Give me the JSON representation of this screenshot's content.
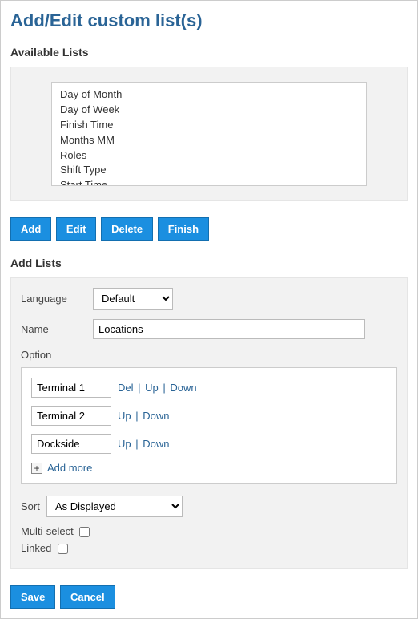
{
  "title": "Add/Edit custom list(s)",
  "available_section_title": "Available Lists",
  "available_lists": [
    "Day of Month",
    "Day of Week",
    "Finish Time",
    "Months MM",
    "Roles",
    "Shift Type",
    "Start Time"
  ],
  "buttons": {
    "add": "Add",
    "edit": "Edit",
    "delete": "Delete",
    "finish": "Finish",
    "save": "Save",
    "cancel": "Cancel"
  },
  "add_lists_title": "Add Lists",
  "labels": {
    "language": "Language",
    "name": "Name",
    "option": "Option",
    "sort": "Sort",
    "multi": "Multi-select",
    "linked": "Linked"
  },
  "language_value": "Default",
  "name_value": "Locations",
  "options": [
    {
      "value": "Terminal 1",
      "actions": [
        "Del",
        "Up",
        "Down"
      ]
    },
    {
      "value": "Terminal 2",
      "actions": [
        "Up",
        "Down"
      ]
    },
    {
      "value": "Dockside",
      "actions": [
        "Up",
        "Down"
      ]
    }
  ],
  "add_more": "Add more",
  "sort_value": "As Displayed",
  "multi_checked": false,
  "linked_checked": false
}
